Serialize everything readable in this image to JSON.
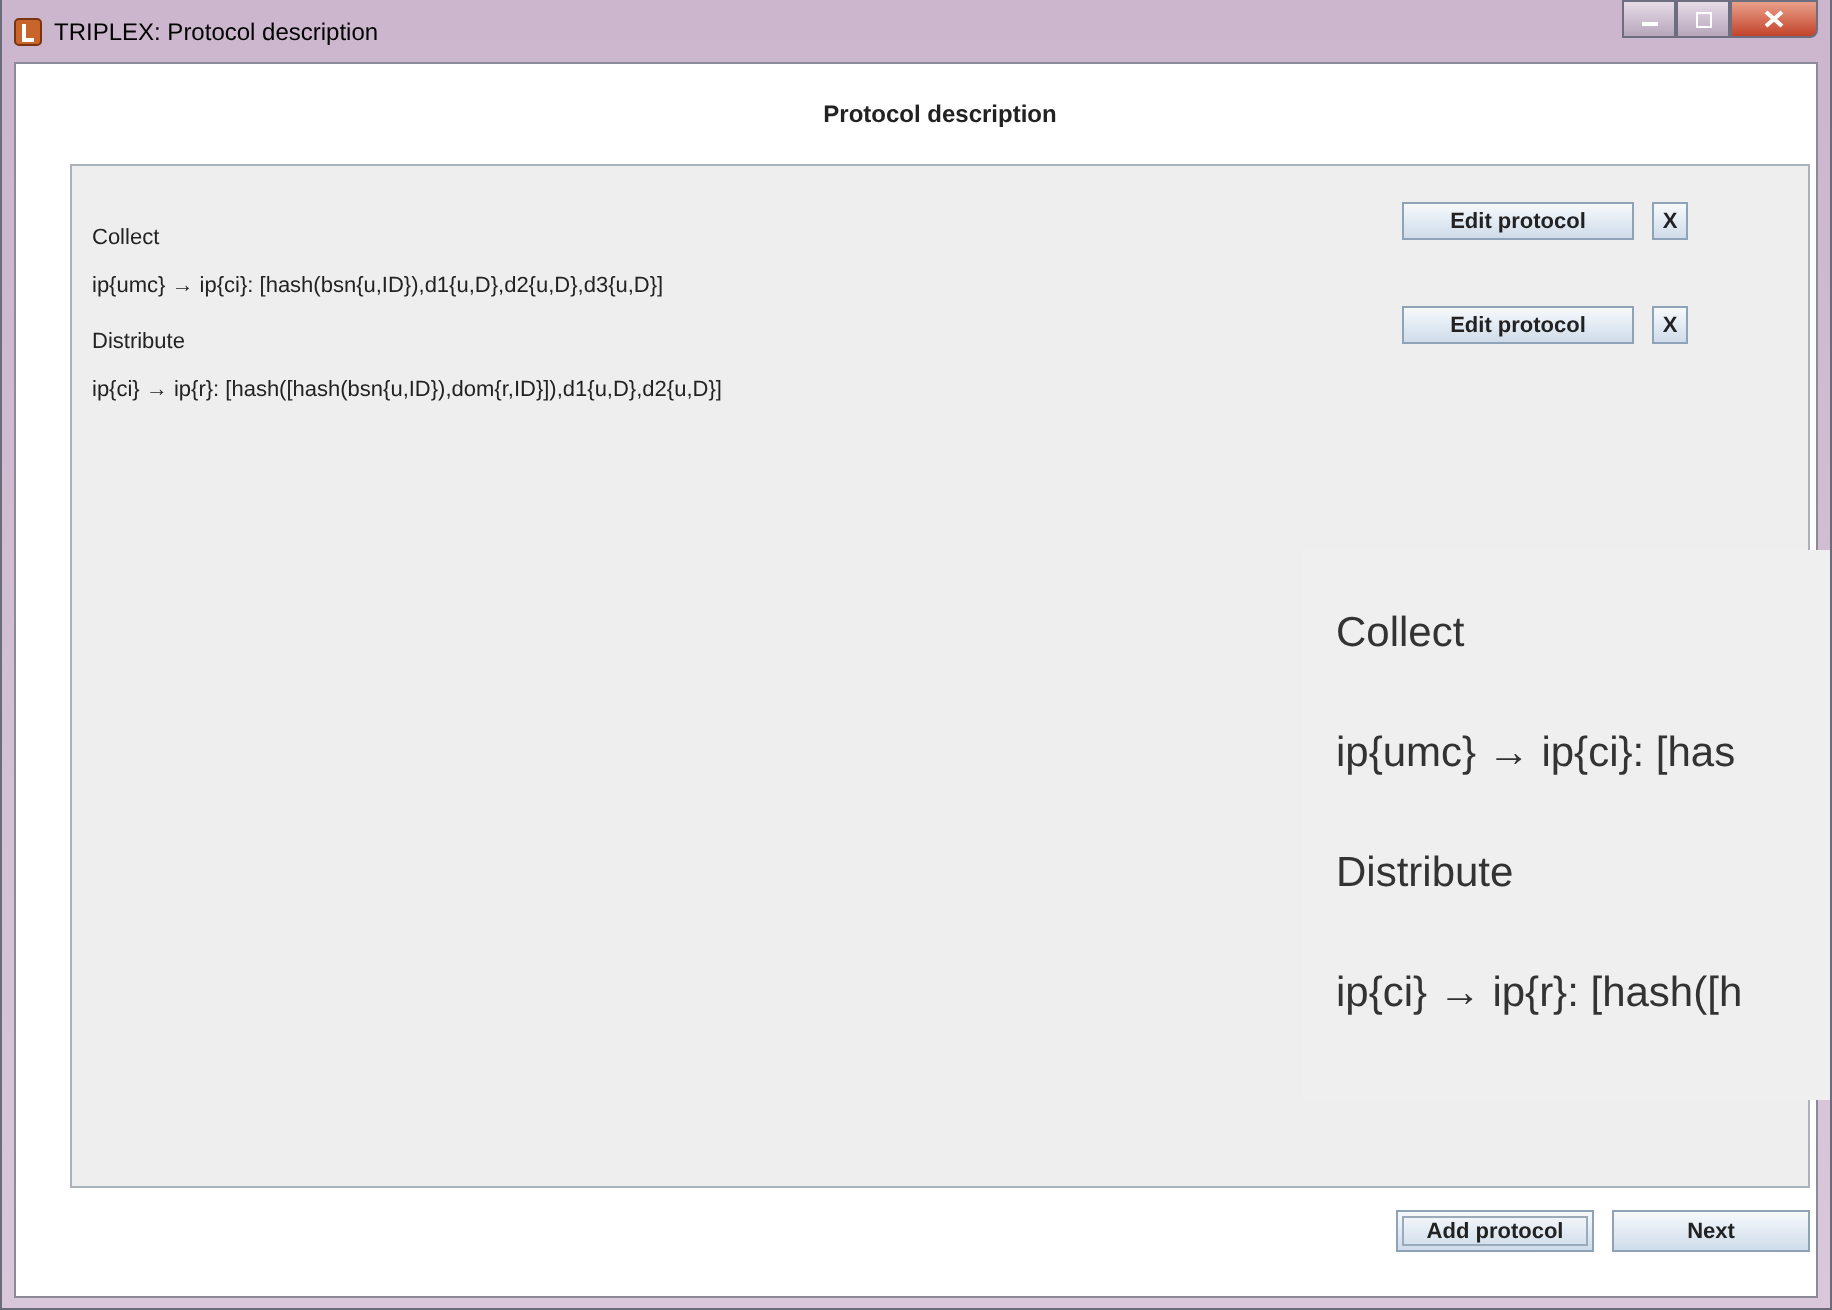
{
  "window": {
    "title": "TRIPLEX: Protocol description"
  },
  "heading": "Protocol description",
  "protocols": [
    {
      "name": "Collect",
      "rule": "ip{umc} → ip{ci}: [hash(bsn{u,ID}),d1{u,D},d2{u,D},d3{u,D}]",
      "edit_button": "Edit protocol",
      "delete_button": "X"
    },
    {
      "name": "Distribute",
      "rule": "ip{ci} → ip{r}: [hash([hash(bsn{u,ID}),dom{r,ID}]),d1{u,D},d2{u,D}]",
      "edit_button": "Edit protocol",
      "delete_button": "X"
    }
  ],
  "magnifier": {
    "protocols": [
      {
        "name": "Collect",
        "rule": "ip{umc} → ip{ci}: [has"
      },
      {
        "name": "Distribute",
        "rule": "ip{ci} → ip{r}: [hash([h"
      }
    ]
  },
  "buttons": [
    {
      "label": "Add protocol",
      "focused": true
    },
    {
      "label": "Next",
      "focused": false
    }
  ]
}
